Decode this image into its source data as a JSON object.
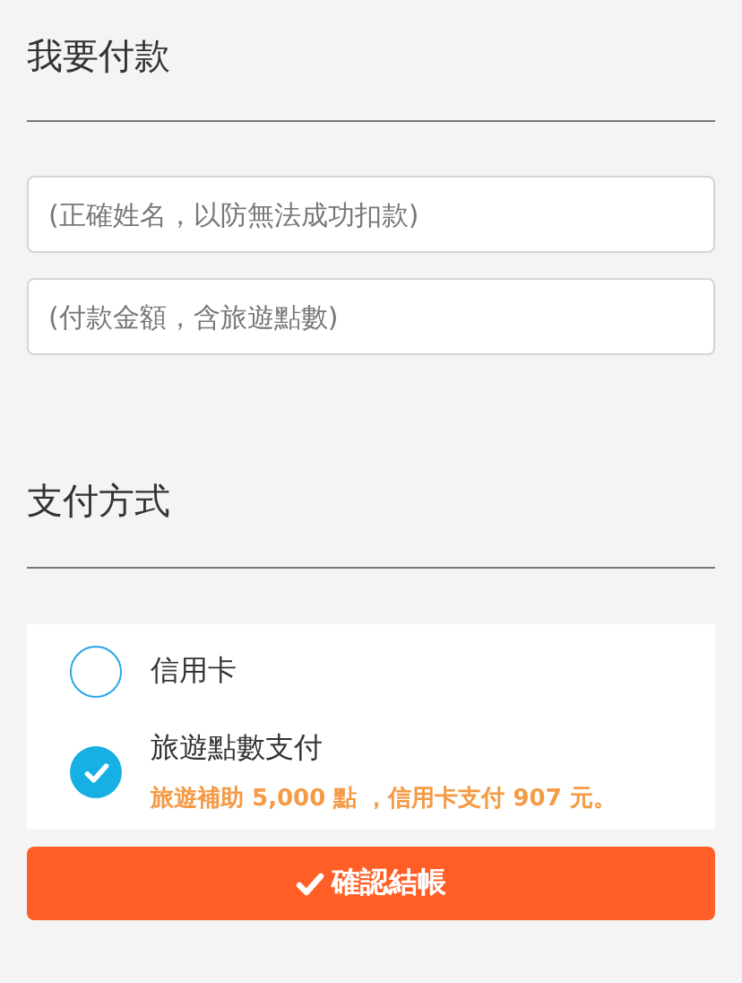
{
  "title": "我要付款",
  "fields": [
    {
      "placeholder": "(正確姓名，以防無法成功扣款)"
    },
    {
      "placeholder": "(付款金額，含旅遊點數)"
    }
  ],
  "payment": {
    "title": "支付方式",
    "options": [
      {
        "label": "信用卡",
        "selected": false
      },
      {
        "label": "旅遊點數支付",
        "selected": true,
        "note": "旅遊補助 5,000 點 ，信用卡支付 907 元。"
      }
    ]
  },
  "submit": {
    "label": "確認結帳"
  }
}
